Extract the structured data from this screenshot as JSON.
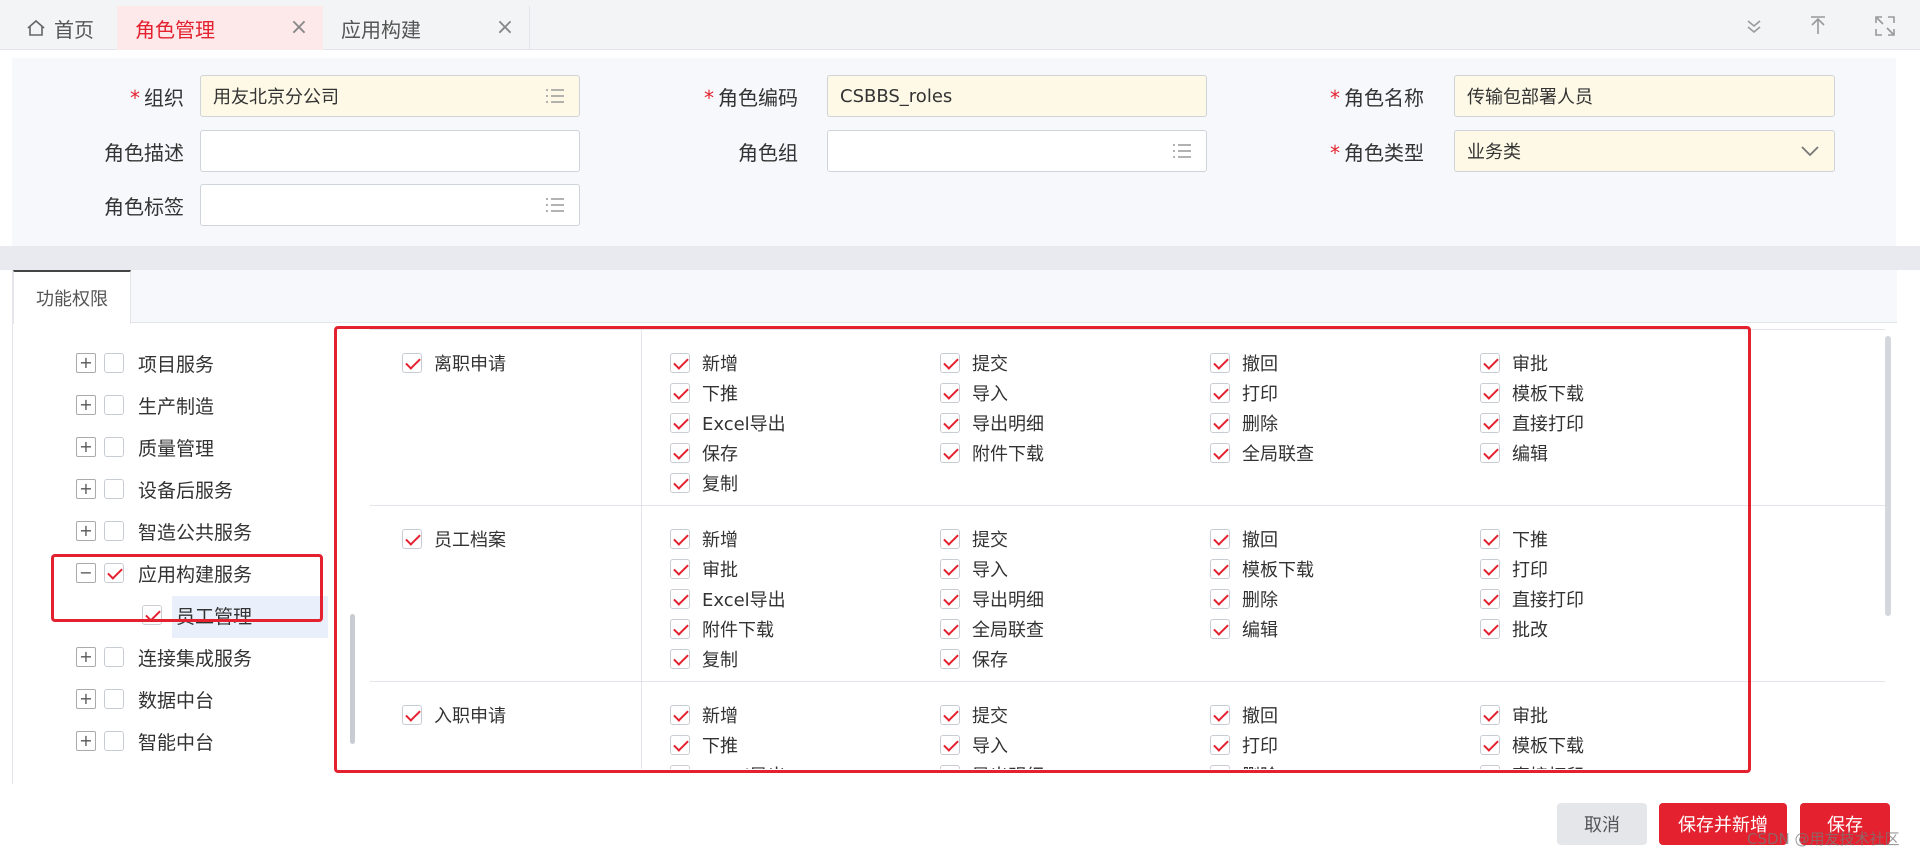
{
  "tabs": [
    {
      "label": "首页"
    },
    {
      "label": "角色管理"
    },
    {
      "label": "应用构建"
    }
  ],
  "tab_close_glyph": "×",
  "form": {
    "org_label": "组织",
    "org_value": "用友北京分公司",
    "code_label": "角色编码",
    "code_value": "CSBBS_roles",
    "name_label": "角色名称",
    "name_value": "传输包部署人员",
    "desc_label": "角色描述",
    "desc_value": "",
    "group_label": "角色组",
    "group_value": "",
    "type_label": "角色类型",
    "type_value": "业务类",
    "tag_label": "角色标签",
    "tag_value": "",
    "required_mark": "*"
  },
  "perm_tab": "功能权限",
  "tree": [
    {
      "label": "项目服务",
      "expander": "+",
      "checked": false
    },
    {
      "label": "生产制造",
      "expander": "+",
      "checked": false
    },
    {
      "label": "质量管理",
      "expander": "+",
      "checked": false
    },
    {
      "label": "设备后服务",
      "expander": "+",
      "checked": false
    },
    {
      "label": "智造公共服务",
      "expander": "+",
      "checked": false
    },
    {
      "label": "应用构建服务",
      "expander": "−",
      "checked": true
    },
    {
      "label": "员工管理",
      "expander": "",
      "checked": true
    },
    {
      "label": "连接集成服务",
      "expander": "+",
      "checked": false
    },
    {
      "label": "数据中台",
      "expander": "+",
      "checked": false
    },
    {
      "label": "智能中台",
      "expander": "+",
      "checked": false
    }
  ],
  "groups": [
    {
      "name": "离职申请",
      "checked": true,
      "perms": [
        "新增",
        "提交",
        "撤回",
        "审批",
        "下推",
        "导入",
        "打印",
        "模板下载",
        "Excel导出",
        "导出明细",
        "删除",
        "直接打印",
        "保存",
        "附件下载",
        "全局联查",
        "编辑",
        "复制"
      ]
    },
    {
      "name": "员工档案",
      "checked": true,
      "perms": [
        "新增",
        "提交",
        "撤回",
        "下推",
        "审批",
        "导入",
        "模板下载",
        "打印",
        "Excel导出",
        "导出明细",
        "删除",
        "直接打印",
        "附件下载",
        "全局联查",
        "编辑",
        "批改",
        "复制",
        "保存"
      ]
    },
    {
      "name": "入职申请",
      "checked": true,
      "perms": [
        "新增",
        "提交",
        "撤回",
        "审批",
        "下推",
        "导入",
        "打印",
        "模板下载",
        "Excel导出",
        "导出明细",
        "删除",
        "直接打印"
      ]
    }
  ],
  "buttons": {
    "cancel": "取消",
    "save_new": "保存并新增",
    "save": "保存"
  },
  "watermark": "CSDN @用友技术社区",
  "colors": {
    "accent": "#e3212f",
    "required_bg": "#fdf9e6",
    "panel_bg": "#f6f8fb"
  }
}
